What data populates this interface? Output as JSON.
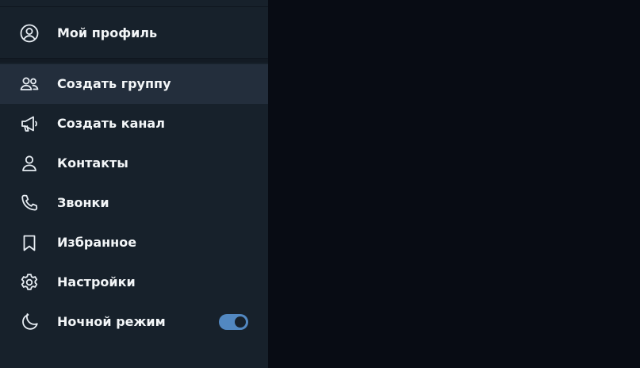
{
  "profile": {
    "label": "Мой профиль",
    "icon": "user-circle-icon"
  },
  "menu": {
    "items": [
      {
        "label": "Создать группу",
        "icon": "group-icon",
        "active": true
      },
      {
        "label": "Создать канал",
        "icon": "megaphone-icon"
      },
      {
        "label": "Контакты",
        "icon": "user-icon"
      },
      {
        "label": "Звонки",
        "icon": "phone-icon"
      },
      {
        "label": "Избранное",
        "icon": "bookmark-icon"
      },
      {
        "label": "Настройки",
        "icon": "gear-icon"
      },
      {
        "label": "Ночной режим",
        "icon": "moon-icon",
        "toggle_on": true
      }
    ]
  },
  "colors": {
    "sidebar_bg": "#17212b",
    "active_item_bg": "#232e3c",
    "main_bg": "#080c14",
    "accent": "#5288c1",
    "text": "#f3f6f8"
  }
}
